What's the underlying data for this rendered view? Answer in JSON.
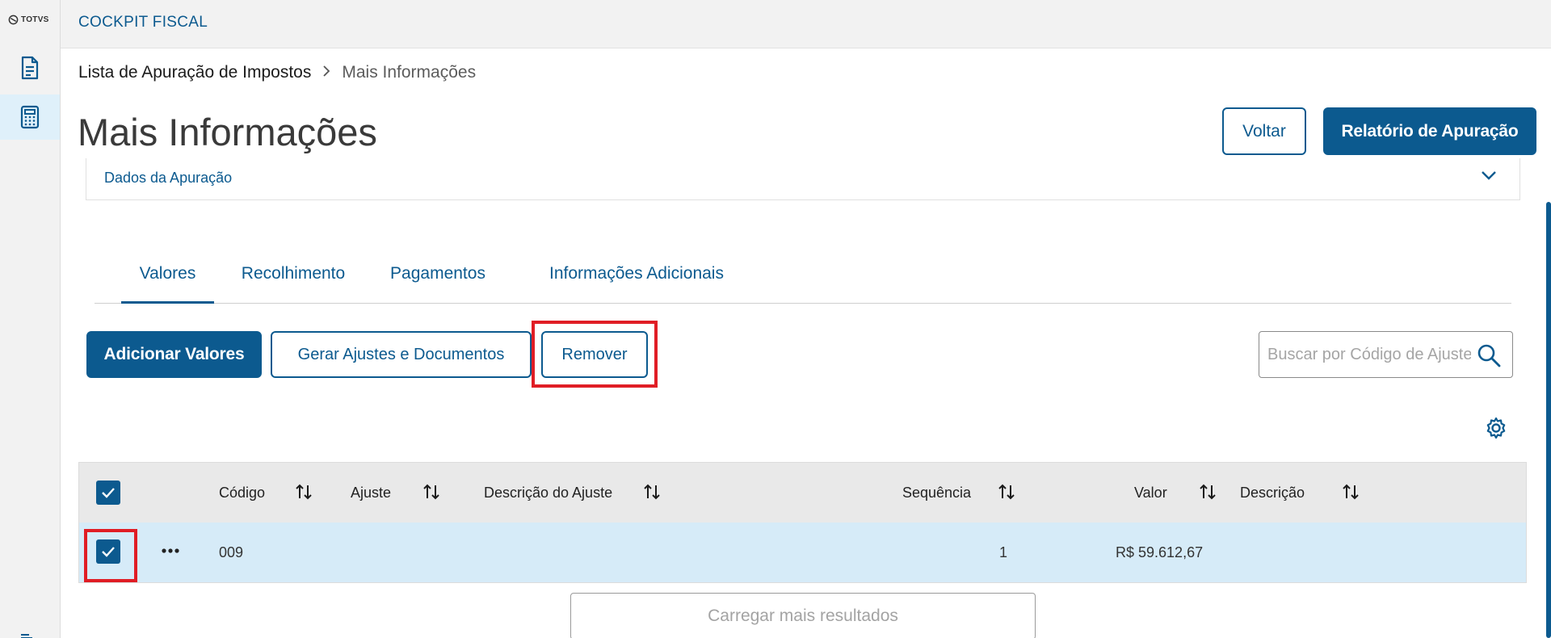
{
  "sidebar": {
    "logo_text": "TOTVS",
    "items": [
      {
        "icon": "document-icon",
        "active": false
      },
      {
        "icon": "calculator-icon",
        "active": true
      }
    ]
  },
  "header": {
    "app_title": "COCKPIT FISCAL"
  },
  "breadcrumb": {
    "items": [
      {
        "label": "Lista de Apuração de Impostos"
      },
      {
        "label": "Mais Informações"
      }
    ]
  },
  "page": {
    "title": "Mais Informações",
    "back_label": "Voltar",
    "report_label": "Relatório de Apuração"
  },
  "section": {
    "title": "Dados da Apuração"
  },
  "tabs": [
    {
      "label": "Valores",
      "active": true
    },
    {
      "label": "Recolhimento",
      "active": false
    },
    {
      "label": "Pagamentos",
      "active": false
    },
    {
      "label": "Informações Adicionais",
      "active": false
    }
  ],
  "actions": {
    "add_label": "Adicionar Valores",
    "generate_label": "Gerar Ajustes e Documentos",
    "remove_label": "Remover"
  },
  "search": {
    "placeholder": "Buscar por Código de Ajuste"
  },
  "table": {
    "columns": [
      "Código",
      "Ajuste",
      "Descrição do Ajuste",
      "Sequência",
      "Valor",
      "Descrição"
    ],
    "rows": [
      {
        "codigo": "009",
        "ajuste": "",
        "descricao_ajuste": "",
        "sequencia": "1",
        "valor": "R$ 59.612,67",
        "descricao": "",
        "selected": true
      }
    ],
    "all_selected": true
  },
  "load_more_label": "Carregar mais resultados",
  "colors": {
    "primary": "#0c5a8f",
    "highlight": "#e01d25",
    "row_selected": "#d6ebf8"
  }
}
